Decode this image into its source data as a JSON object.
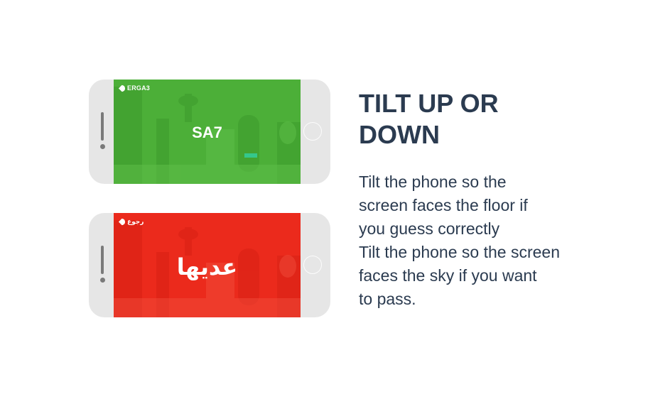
{
  "instructions": {
    "title_line1": "TILT UP OR",
    "title_line2": "DOWN",
    "lines": [
      "Tilt the phone so the",
      "screen faces the floor if",
      "you guess correctly",
      "Tilt the phone so the screen",
      "faces the sky if you want",
      "to pass."
    ]
  },
  "phones": {
    "correct": {
      "back_label": "ERGA3",
      "word": "SA7",
      "screen_color": "#4caf38"
    },
    "pass": {
      "back_label": "رجوع",
      "word": "عديها",
      "screen_color": "#eb2a1c"
    }
  },
  "icons": {
    "back": "back-arrow-icon",
    "home": "home-button-icon"
  }
}
